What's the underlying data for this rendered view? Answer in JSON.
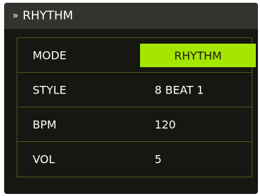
{
  "header": {
    "icon": "double-chevron-right-icon",
    "chevron_glyph": "»",
    "title": "RHYTHM"
  },
  "rows": [
    {
      "label": "MODE",
      "value": "RHYTHM"
    },
    {
      "label": "STYLE",
      "value": "8 BEAT 1"
    },
    {
      "label": "BPM",
      "value": "120"
    },
    {
      "label": "VOL",
      "value": "5"
    }
  ],
  "colors": {
    "background": "#161712",
    "header": "#333430",
    "accent": "#a5e600",
    "divider": "#4c5a1e"
  }
}
